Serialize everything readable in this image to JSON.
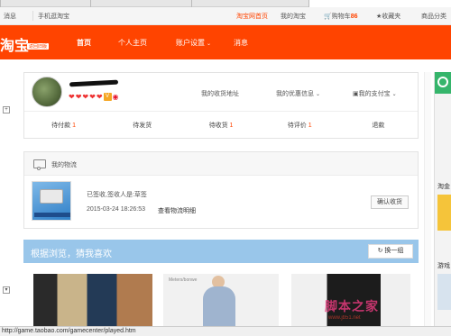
{
  "topbar": {
    "messages": "消息",
    "mobile_taobao": "手机逛淘宝",
    "taobao_home": "淘宝网首页",
    "my_taobao": "我的淘宝",
    "cart_label": "购物车",
    "cart_count": "86",
    "favorites": "收藏夹",
    "category": "商品分类"
  },
  "nav": {
    "logo": "淘宝",
    "logo_badge": "返回旧版",
    "items": [
      "首页",
      "个人主页",
      "账户设置",
      "消息"
    ]
  },
  "profile": {
    "badges": [
      "❤",
      "❤",
      "❤",
      "❤",
      "❤",
      "V"
    ],
    "links": [
      "我的收货地址",
      "我的优惠信息",
      "我的支付宝"
    ],
    "orders": [
      {
        "label": "待付款",
        "count": "1"
      },
      {
        "label": "待发货",
        "count": ""
      },
      {
        "label": "待收货",
        "count": "1"
      },
      {
        "label": "待评价",
        "count": "1"
      },
      {
        "label": "退款",
        "count": ""
      }
    ]
  },
  "logistics": {
    "title": "我的物流",
    "status": "已签收,签收人是:草签",
    "date": "2015-03-24 18:26:53",
    "detail_link": "查看物流明细",
    "confirm_button": "确认收货"
  },
  "recommend": {
    "title": "根据浏览，猜我喜欢",
    "refresh_button": "换一组",
    "tile2_brand": "Meters/bonwe"
  },
  "right_panel": {
    "text1": "淘金",
    "text2": "游戏"
  },
  "statusbar": {
    "url": "http://game.taobao.com/gamecenter/played.htm"
  },
  "watermark": {
    "text": "脚本之家",
    "sub": "www.jb51.net"
  }
}
